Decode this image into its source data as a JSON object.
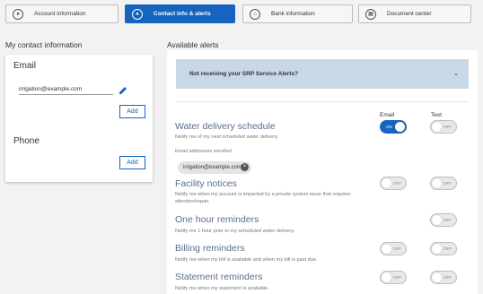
{
  "tabs": [
    {
      "label": "Account information",
      "icon": "person-icon",
      "active": false
    },
    {
      "label": "Contact info & alerts",
      "icon": "person-icon",
      "active": true
    },
    {
      "label": "Bank information",
      "icon": "bank-icon",
      "active": false
    },
    {
      "label": "Document center",
      "icon": "document-icon",
      "active": false
    }
  ],
  "contact": {
    "heading": "My contact information",
    "email_title": "Email",
    "email_value": "irrigation@example.com",
    "add_label": "Add",
    "phone_title": "Phone"
  },
  "alerts": {
    "heading": "Available alerts",
    "notice": "Not receiving your SRP Service Alerts?",
    "col_email": "Email",
    "col_text": "Text",
    "enrolled_label": "Email addresses enrolled",
    "enrolled_email": "irrigation@example.com",
    "toggle_on_label": "ON",
    "toggle_off_label": "OFF",
    "items": [
      {
        "title": "Water delivery schedule",
        "desc": "Notify me of my next scheduled water delivery.",
        "email_on": true,
        "text_on": false
      },
      {
        "title": "Facility notices",
        "desc": "Notify me when my account is impacted by a private system issue that requires attention/repair.",
        "email_on": false,
        "text_on": false
      },
      {
        "title": "One hour reminders",
        "desc": "Notify me 1 hour prior to my scheduled water delivery.",
        "email_on": null,
        "text_on": false
      },
      {
        "title": "Billing reminders",
        "desc": "Notify me when my bill is available and when my bill is past due.",
        "email_on": false,
        "text_on": false
      },
      {
        "title": "Statement reminders",
        "desc": "Notify me when my statement is available.",
        "email_on": false,
        "text_on": false
      }
    ]
  },
  "colors": {
    "accent": "#1565c0",
    "notice_bg": "#c9d8e6",
    "alert_title": "#5b6f8c"
  }
}
